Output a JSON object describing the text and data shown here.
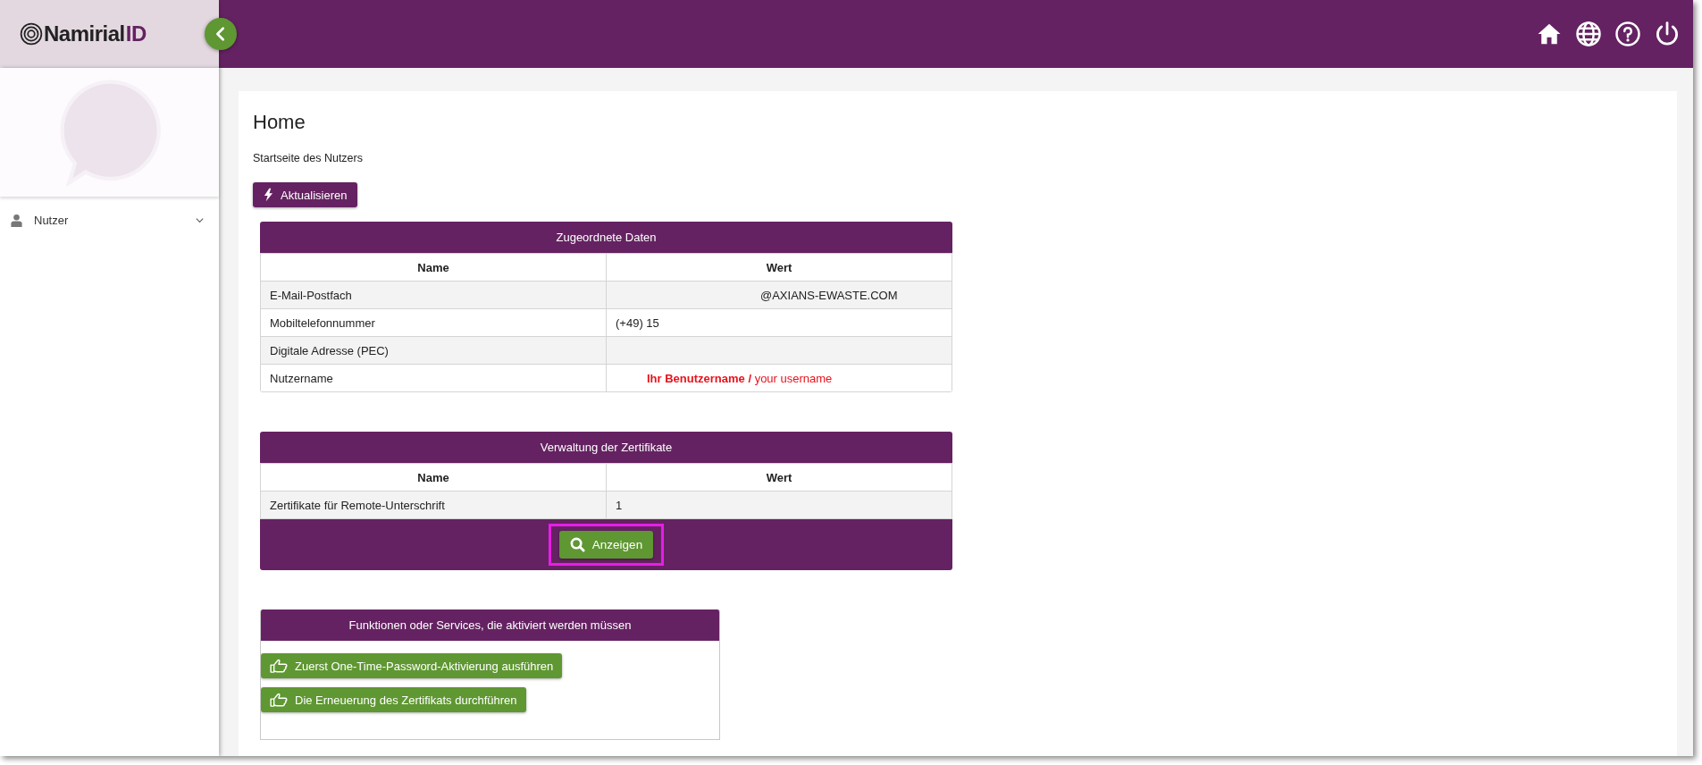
{
  "header": {
    "logo": "Namirial",
    "logo_suffix": "ID",
    "sidebar_collapsed": false
  },
  "sidebar": {
    "items": [
      {
        "label": "Nutzer",
        "expanded": false
      }
    ]
  },
  "page": {
    "title": "Home",
    "subtitle": "Startseite des Nutzers",
    "refresh_button": "Aktualisieren"
  },
  "assigned_data": {
    "title": "Zugeordnete Daten",
    "columns": [
      "Name",
      "Wert"
    ],
    "rows": [
      {
        "name": "E-Mail-Postfach",
        "value": "@AXIANS-EWASTE.COM",
        "kind": "offset"
      },
      {
        "name": "Mobiltelefonnummer",
        "value": "(+49) 15",
        "kind": "plain"
      },
      {
        "name": "Digitale Adresse (PEC)",
        "kind": "plain"
      },
      {
        "name": "Nutzername",
        "value": "**Ihr Benutzername /** your username",
        "kind": "note"
      }
    ]
  },
  "certificates": {
    "title": "Verwaltung der Zertifikate",
    "columns": [
      "Name",
      "Wert"
    ],
    "rows": [
      {
        "name": "Zertifikate für Remote-Unterschrift",
        "value": "1"
      }
    ],
    "button": {
      "label": "Anzeigen",
      "highlighted": true
    }
  },
  "services": {
    "title": "Funktionen oder Services, die aktiviert werden müssen",
    "buttons": [
      "Zuerst One-Time-Password-Aktivierung ausführen",
      "Die Erneuerung des Zertifikats durchführen"
    ]
  }
}
